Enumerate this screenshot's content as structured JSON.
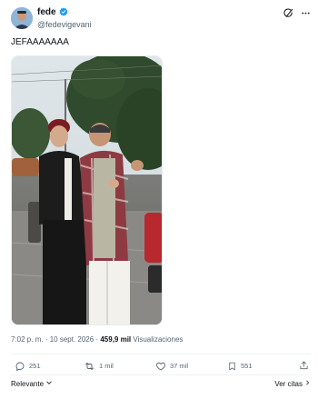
{
  "author": {
    "display_name": "fede",
    "handle": "@fedevigevani",
    "verified_color": "#1d9bf0"
  },
  "tweet": {
    "text": "JEFAAAAAAA"
  },
  "meta": {
    "time": "7:02 p. m.",
    "separator": "·",
    "date": "10 sept. 2026",
    "views_count": "459,9 mil",
    "views_label": "Visualizaciones"
  },
  "actions": {
    "replies": "251",
    "reposts": "1 mil",
    "likes": "37 mil",
    "bookmarks": "551"
  },
  "footer": {
    "sort_label": "Relevante",
    "see_quotes_label": "Ver citas"
  },
  "icons": {
    "header": [
      "grok-icon",
      "more-icon"
    ],
    "actions": [
      "reply-icon",
      "repost-icon",
      "like-icon",
      "bookmark-icon",
      "share-icon"
    ]
  },
  "colors": {
    "text_primary": "#0f1419",
    "text_secondary": "#536471",
    "verified": "#1d9bf0"
  }
}
